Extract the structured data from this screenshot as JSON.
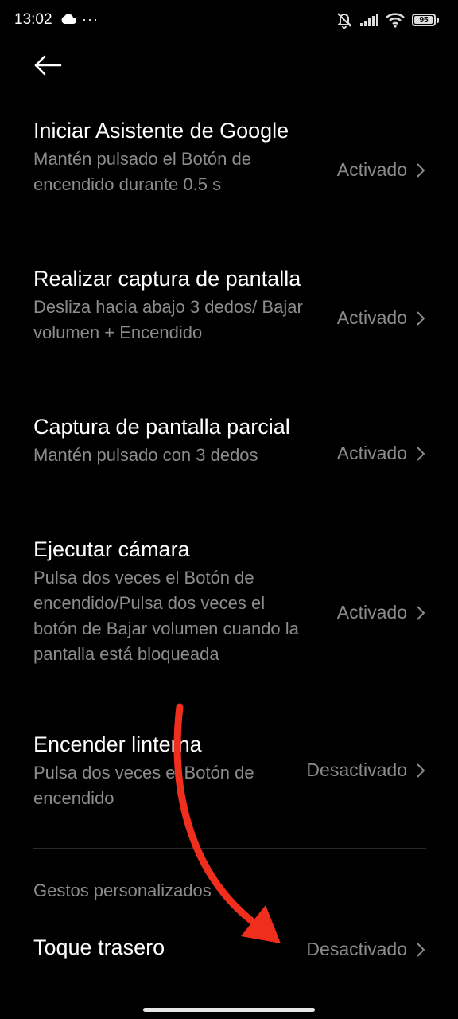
{
  "status_bar": {
    "time": "13:02",
    "more_indicator": "···",
    "battery": 95,
    "battery_label": "95",
    "icons": [
      "cloud-icon",
      "bell-off-icon",
      "signal-icon",
      "wifi-icon",
      "battery-icon"
    ]
  },
  "header": {
    "back_icon": "arrow-left-icon"
  },
  "settings": [
    {
      "title": "Iniciar Asistente de Google",
      "subtitle": "Mantén pulsado el Botón de encendido durante 0.5 s",
      "value": "Activado"
    },
    {
      "title": "Realizar captura de pantalla",
      "subtitle": "Desliza hacia abajo 3 dedos/ Bajar volumen + Encendido",
      "value": "Activado"
    },
    {
      "title": "Captura de pantalla parcial",
      "subtitle": "Mantén pulsado con 3 dedos",
      "value": "Activado"
    },
    {
      "title": "Ejecutar cámara",
      "subtitle": "Pulsa dos veces el Botón de encendido/Pulsa dos veces el botón de Bajar volumen cuando la pantalla está bloqueada",
      "value": "Activado"
    },
    {
      "title": "Encender linterna",
      "subtitle": "Pulsa dos veces el Botón de encendido",
      "value": "Desactivado"
    }
  ],
  "custom_gestures": {
    "section_title": "Gestos personalizados",
    "items": [
      {
        "title": "Toque trasero",
        "value": "Desactivado"
      }
    ]
  },
  "colors": {
    "background": "#000000",
    "primary_text": "#ffffff",
    "secondary_text": "#8c8c8c",
    "annotation_arrow": "#f02e1e"
  }
}
